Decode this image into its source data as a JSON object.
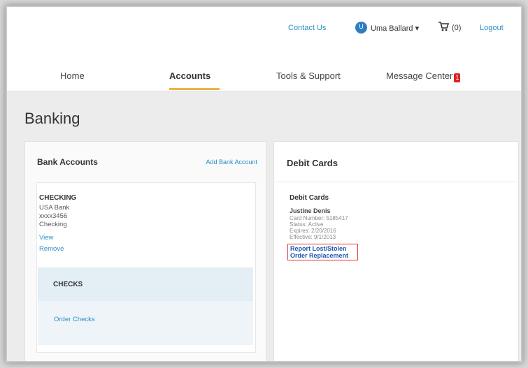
{
  "utility": {
    "contact_us": "Contact Us",
    "user_name": "Uma Ballard ▾",
    "user_initial": "U",
    "cart_count": "(0)",
    "logout": "Logout"
  },
  "nav": {
    "items": [
      {
        "label": "Home"
      },
      {
        "label": "Accounts"
      },
      {
        "label": "Tools & Support"
      },
      {
        "label": "Message Center"
      }
    ],
    "active": "Accounts",
    "badge": "1"
  },
  "page": {
    "title": "Banking"
  },
  "bank_accounts": {
    "title": "Bank Accounts",
    "add_link": "Add Bank Account",
    "account": {
      "type": "CHECKING",
      "lines": [
        "USA Bank",
        "xxxx3456",
        "Checking"
      ],
      "view_label": "View",
      "remove_label": "Remove"
    },
    "checks": {
      "title": "CHECKS",
      "order_label": "Order Checks"
    }
  },
  "debit_cards": {
    "title": "Debit Cards",
    "subtitle": "Debit Cards",
    "card": {
      "holder": "Justine Denis",
      "details": [
        "Card Number: 5185417",
        "Status: Active",
        "Expires: 2/20/2016",
        "Effective: 9/1/2013"
      ],
      "report_label": "Report Lost/Stolen",
      "replace_label": "Order Replacement"
    }
  },
  "colors": {
    "link": "#2a8fc4",
    "active_underline": "#f0b04a",
    "alert": "#e02020",
    "highlight_box": "#e03535"
  }
}
